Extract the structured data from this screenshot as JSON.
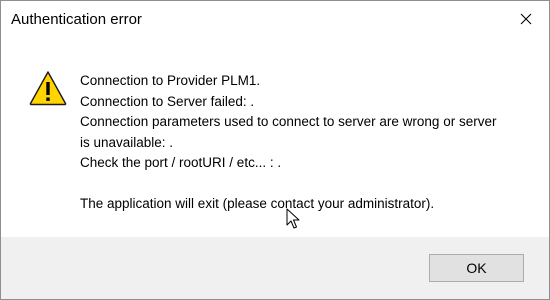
{
  "window": {
    "title": "Authentication error",
    "close_icon": "close-icon"
  },
  "message": {
    "icon": "warning-icon",
    "lines": [
      "Connection to Provider PLM1.",
      "Connection to Server failed: .",
      "Connection parameters used to connect to server are wrong or server",
      "is unavailable: .",
      "Check the port / rootURI / etc... : ."
    ],
    "footer_line": "The application will exit (please contact your administrator)."
  },
  "buttons": {
    "ok_label": "OK"
  },
  "colors": {
    "warning_fill": "#ffd400",
    "footer_bg": "#f0f0f0",
    "button_bg": "#e1e1e1"
  }
}
